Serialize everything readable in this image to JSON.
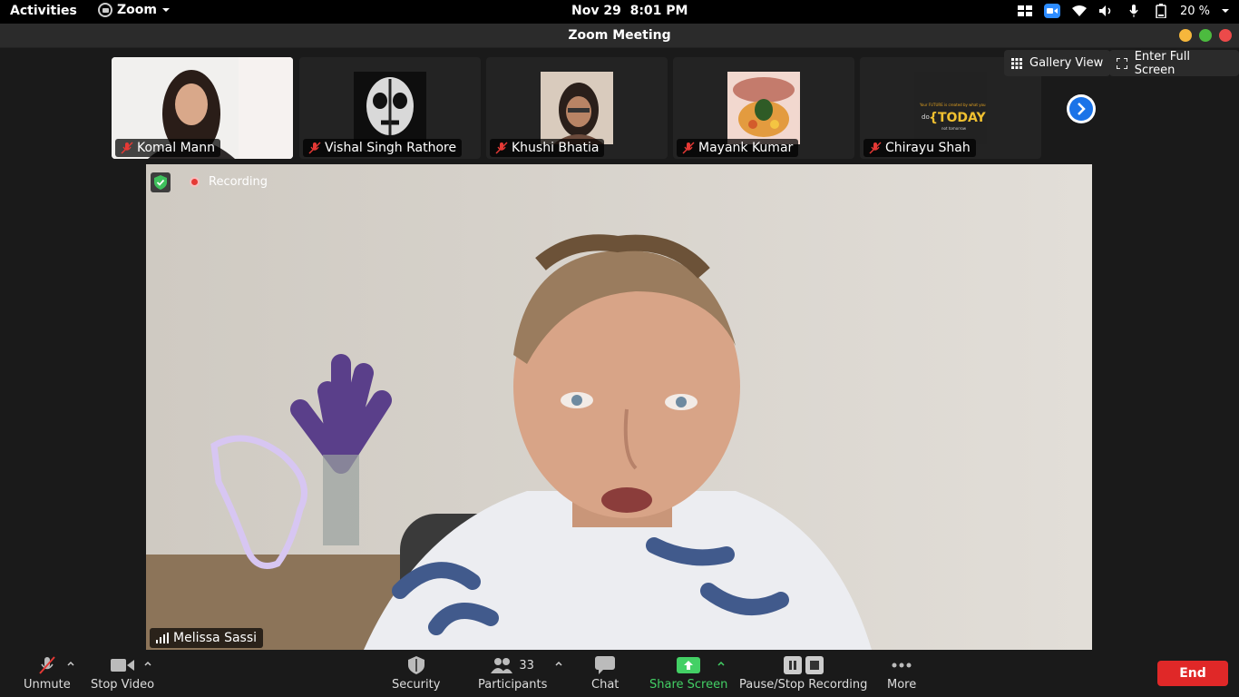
{
  "topbar": {
    "activities": "Activities",
    "app_name": "Zoom",
    "clock_date": "Nov 29",
    "clock_time": "8:01 PM",
    "battery": "20 %"
  },
  "window": {
    "title": "Zoom Meeting"
  },
  "view": {
    "gallery_view": "Gallery View",
    "enter_full_screen": "Enter Full Screen"
  },
  "participants_strip": [
    {
      "name": "Komal Mann"
    },
    {
      "name": "Vishal Singh Rathore"
    },
    {
      "name": "Khushi Bhatia"
    },
    {
      "name": "Mayank Kumar"
    },
    {
      "name": "Chirayu Shah"
    }
  ],
  "thumbnail_text": {
    "small": "Your FUTURE is created by what you",
    "do": "do",
    "today": "{TODAY}",
    "not_tomorrow": "not tomorrow"
  },
  "speaker": {
    "name": "Melissa Sassi",
    "recording": "Recording"
  },
  "controls": {
    "unmute": "Unmute",
    "stop_video": "Stop Video",
    "security": "Security",
    "participants": "Participants",
    "participants_count": "33",
    "chat": "Chat",
    "share_screen": "Share Screen",
    "recording": "Pause/Stop Recording",
    "more": "More",
    "end": "End"
  },
  "colors": {
    "end_red": "#e02828",
    "share_green": "#43d065",
    "mute_red": "#e53935",
    "zoom_blue": "#2d8cff"
  }
}
